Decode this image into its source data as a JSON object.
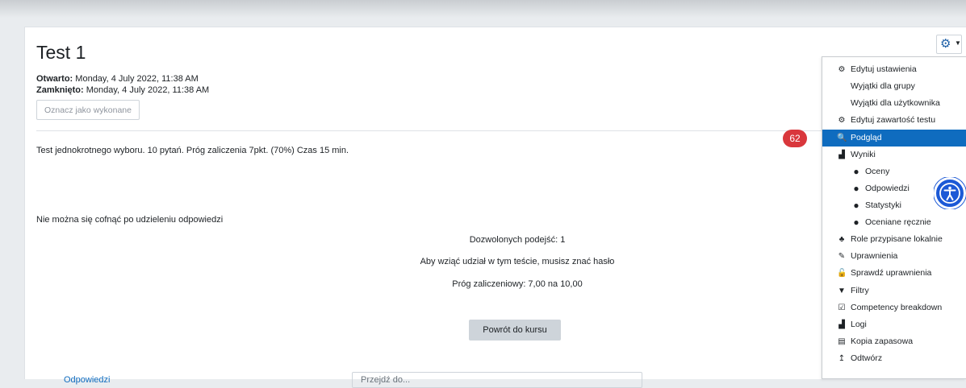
{
  "page": {
    "title": "Test 1",
    "opened_label": "Otwarto:",
    "opened_value": " Monday, 4 July 2022, 11:38 AM",
    "closed_label": "Zamknięto:",
    "closed_value": " Monday, 4 July 2022, 11:38 AM",
    "mark_done_button": "Oznacz jako wykonane",
    "intro_line1": "Test jednokrotnego wyboru. 10 pytań. Próg zaliczenia 7pkt. (70%) Czas 15 min.",
    "intro_line2": "Nie można się cofnąć po udzieleniu odpowiedzi",
    "attempts_allowed": "Dozwolonych podejść: 1",
    "password_required": "Aby wziąć udział w tym teście, musisz znać hasło",
    "grade_to_pass": "Próg zaliczeniowy: 7,00 na 10,00",
    "back_button": "Powrót do kursu",
    "bottom_left_partial": "Odpowiedzi",
    "bottom_select_partial": "Przejdź do..."
  },
  "badge": {
    "count": "62",
    "color": "#d9373c"
  },
  "menu": {
    "accent": "#0f6cbf",
    "items": [
      {
        "label": "Edytuj ustawienia",
        "icon": "gear-icon",
        "glyph": "⚙"
      },
      {
        "label": "Wyjątki dla grupy",
        "icon": "",
        "glyph": ""
      },
      {
        "label": "Wyjątki dla użytkownika",
        "icon": "",
        "glyph": ""
      },
      {
        "label": "Edytuj zawartość testu",
        "icon": "gear-icon",
        "glyph": "⚙"
      },
      {
        "label": "Podgląd",
        "icon": "magnifier-icon",
        "glyph": "🔍",
        "active": true
      },
      {
        "label": "Wyniki",
        "icon": "chart-area-icon",
        "glyph": "▟"
      },
      {
        "label": "Oceny",
        "icon": "bullet-icon",
        "glyph": "●"
      },
      {
        "label": "Odpowiedzi",
        "icon": "bullet-icon",
        "glyph": "●"
      },
      {
        "label": "Statystyki",
        "icon": "bullet-icon",
        "glyph": "●"
      },
      {
        "label": "Oceniane ręcznie",
        "icon": "bullet-icon",
        "glyph": "●"
      },
      {
        "label": "Role przypisane lokalnie",
        "icon": "users-icon",
        "glyph": "♣"
      },
      {
        "label": "Uprawnienia",
        "icon": "edit-icon",
        "glyph": "✎"
      },
      {
        "label": "Sprawdź uprawnienia",
        "icon": "unlock-icon",
        "glyph": "🔓"
      },
      {
        "label": "Filtry",
        "icon": "filter-icon",
        "glyph": "▼"
      },
      {
        "label": "Competency breakdown",
        "icon": "check-square-icon",
        "glyph": "☑"
      },
      {
        "label": "Logi",
        "icon": "chart-area-icon",
        "glyph": "▟"
      },
      {
        "label": "Kopia zapasowa",
        "icon": "file-icon",
        "glyph": "▤"
      },
      {
        "label": "Odtwórz",
        "icon": "upload-icon",
        "glyph": "↥"
      }
    ]
  }
}
